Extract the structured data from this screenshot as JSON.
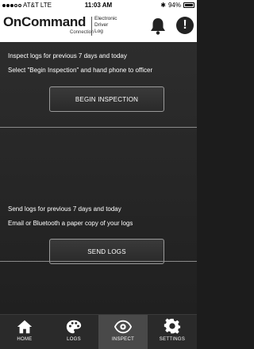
{
  "status_bar": {
    "carrier": "AT&T",
    "network": "LTE",
    "time": "11:03 AM",
    "battery": "94%"
  },
  "header": {
    "logo_main": "OnCommand",
    "logo_sub": "Connection",
    "logo_text": [
      "Electronic",
      "Driver",
      "Log"
    ]
  },
  "inspect_section": {
    "line1": "Inspect logs for previous 7 days and today",
    "line2": "Select \"Begin Inspection\" and hand phone to officer",
    "button_label": "BEGIN INSPECTION"
  },
  "send_section": {
    "line1": "Send logs for previous 7 days and today",
    "line2": "Email or Bluetooth a paper copy of your logs",
    "button_label": "SEND LOGS"
  },
  "tabs": [
    {
      "label": "HOME",
      "icon": "home-icon",
      "active": false
    },
    {
      "label": "LOGS",
      "icon": "palette-icon",
      "active": false
    },
    {
      "label": "INSPECT",
      "icon": "eye-icon",
      "active": true
    },
    {
      "label": "SETTINGS",
      "icon": "gear-icon",
      "active": false
    }
  ],
  "colors": {
    "background": "#1c1c1c",
    "header": "#ffffff",
    "tab_active": "#494949",
    "tab_bar": "#2a2a2a"
  }
}
